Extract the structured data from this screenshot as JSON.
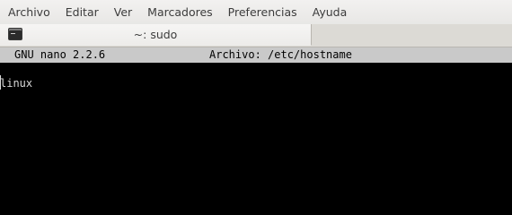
{
  "menubar": {
    "items": [
      {
        "label": "Archivo"
      },
      {
        "label": "Editar"
      },
      {
        "label": "Ver"
      },
      {
        "label": "Marcadores"
      },
      {
        "label": "Preferencias"
      },
      {
        "label": "Ayuda"
      }
    ]
  },
  "tab": {
    "title": "~: sudo",
    "icon": "terminal-icon"
  },
  "nano": {
    "version": "GNU nano 2.2.6",
    "file_label": "Archivo: /etc/hostname"
  },
  "editor": {
    "lines": [
      "linux"
    ]
  }
}
